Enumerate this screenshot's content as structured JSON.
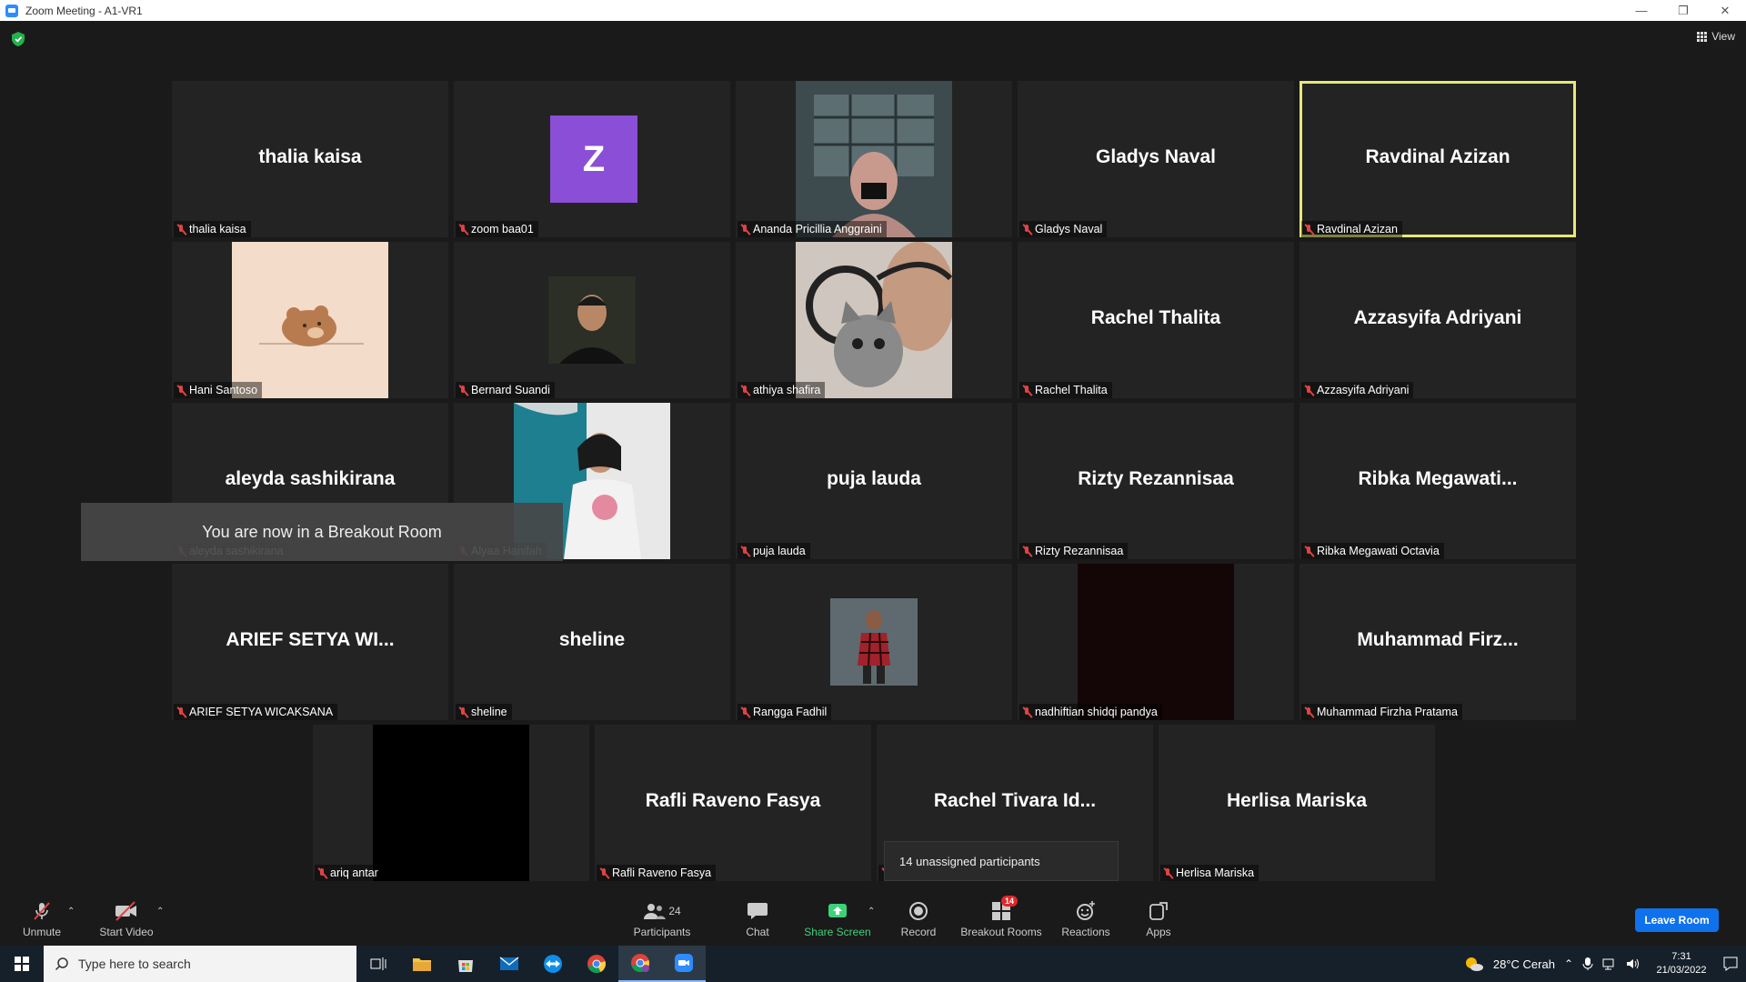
{
  "window": {
    "title": "Zoom Meeting - A1-VR1",
    "min": "—",
    "max": "❐",
    "close": "✕"
  },
  "view_label": "View",
  "tiles": [
    {
      "big": "thalia kaisa",
      "label": "thalia kaisa"
    },
    {
      "big": "Z",
      "label": "zoom baa01",
      "avatar_color": "#8a4fd6"
    },
    {
      "big": "",
      "label": "Ananda Pricillia Anggraini",
      "photo": "photo-ananda"
    },
    {
      "big": "Gladys Naval",
      "label": "Gladys Naval"
    },
    {
      "big": "Ravdinal Azizan",
      "label": "Ravdinal Azizan",
      "active": true
    },
    {
      "big": "",
      "label": "Hani Santoso",
      "photo": "bear-avatar"
    },
    {
      "big": "",
      "label": "Bernard Suandi",
      "photo": "photo-bernard"
    },
    {
      "big": "",
      "label": "athiya shafira",
      "photo": "photo-cat"
    },
    {
      "big": "Rachel Thalita",
      "label": "Rachel Thalita"
    },
    {
      "big": "Azzasyifa Adriyani",
      "label": "Azzasyifa Adriyani"
    },
    {
      "big": "aleyda sashikirana",
      "label": "aleyda sashikirana"
    },
    {
      "big": "",
      "label": "Alyaa Hanifah",
      "photo": "photo-alyaa"
    },
    {
      "big": "puja lauda",
      "label": "puja lauda"
    },
    {
      "big": "Rizty Rezannisaa",
      "label": "Rizty Rezannisaa"
    },
    {
      "big": "Ribka  Megawati...",
      "label": "Ribka Megawati Octavia"
    },
    {
      "big": "ARIEF  SETYA  WI...",
      "label": "ARIEF SETYA WICAKSANA"
    },
    {
      "big": "sheline",
      "label": "sheline"
    },
    {
      "big": "",
      "label": "Rangga Fadhil",
      "photo": "photo-rangga"
    },
    {
      "big": "",
      "label": "nadhiftian shidqi pandya",
      "photo": "dark-video"
    },
    {
      "big": "Muhammad  Firz...",
      "label": "Muhammad Firzha Pratama"
    },
    {
      "big": "",
      "label": "ariq antar",
      "photo": "black-video"
    },
    {
      "big": "Rafli Raveno Fasya",
      "label": "Rafli Raveno Fasya"
    },
    {
      "big": "Rachel Tivara Id...",
      "label": ""
    },
    {
      "big": "Herlisa Mariska",
      "label": "Herlisa Mariska"
    }
  ],
  "toast": "You are now in a Breakout Room",
  "tooltip": "14 unassigned participants",
  "toolbar": {
    "unmute": "Unmute",
    "start_video": "Start Video",
    "participants": "Participants",
    "participants_count": "24",
    "chat": "Chat",
    "share": "Share Screen",
    "record": "Record",
    "breakout": "Breakout Rooms",
    "breakout_badge": "14",
    "reactions": "Reactions",
    "apps": "Apps",
    "leave": "Leave Room"
  },
  "taskbar": {
    "search_placeholder": "Type here to search",
    "weather": "28°C  Cerah",
    "time": "7:31",
    "date": "21/03/2022"
  }
}
